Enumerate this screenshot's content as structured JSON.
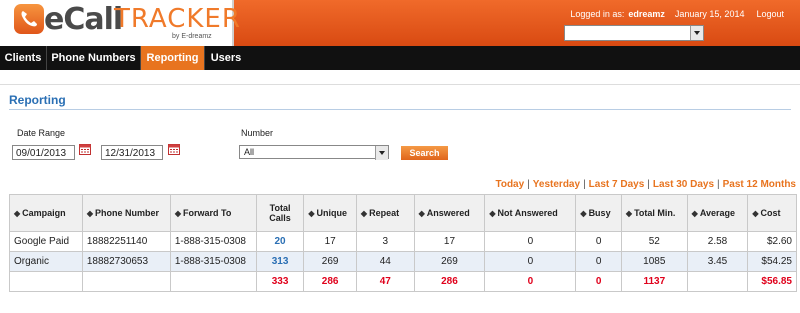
{
  "header": {
    "logo": {
      "brand_e": "eCall",
      "brand_tracker": "TRACKER",
      "byline": "by E-dreamz"
    },
    "logged_in_label": "Logged in as:",
    "username": "edreamz",
    "date": "January 15, 2014",
    "logout_label": "Logout",
    "client_select_value": ""
  },
  "nav": {
    "tabs": [
      {
        "label": "Clients",
        "active": false
      },
      {
        "label": "Phone Numbers",
        "active": false
      },
      {
        "label": "Reporting",
        "active": true
      },
      {
        "label": "Users",
        "active": false
      }
    ]
  },
  "page": {
    "title": "Reporting"
  },
  "filters": {
    "date_range_label": "Date Range",
    "start_date": "09/01/2013",
    "end_date": "12/31/2013",
    "number_label": "Number",
    "number_value": "All",
    "search_label": "Search"
  },
  "quick_ranges": [
    "Today",
    "Yesterday",
    "Last 7 Days",
    "Last 30 Days",
    "Past 12 Months"
  ],
  "table": {
    "sort_glyph": "◆",
    "columns": [
      "Campaign",
      "Phone Number",
      "Forward To",
      "Total Calls",
      "Unique",
      "Repeat",
      "Answered",
      "Not Answered",
      "Busy",
      "Total Min.",
      "Average",
      "Cost"
    ],
    "rows": [
      {
        "campaign": "Google Paid",
        "phone": "18882251140",
        "forward": "1-888-315-0308",
        "total_calls": "20",
        "unique": "17",
        "repeat": "3",
        "answered": "17",
        "not_answered": "0",
        "busy": "0",
        "total_min": "52",
        "average": "2.58",
        "cost": "$2.60"
      },
      {
        "campaign": "Organic",
        "phone": "18882730653",
        "forward": "1-888-315-0308",
        "total_calls": "313",
        "unique": "269",
        "repeat": "44",
        "answered": "269",
        "not_answered": "0",
        "busy": "0",
        "total_min": "1085",
        "average": "3.45",
        "cost": "$54.25"
      }
    ],
    "totals": {
      "total_calls": "333",
      "unique": "286",
      "repeat": "47",
      "answered": "286",
      "not_answered": "0",
      "busy": "0",
      "total_min": "1137",
      "average": "",
      "cost": "$56.85"
    }
  },
  "colors": {
    "accent": "#e8741f",
    "nav_bg": "#111111",
    "title_blue": "#2a6fb4",
    "totals_red": "#e0001b",
    "alt_row": "#e9eff7"
  },
  "icons": {
    "calendar": "calendar-icon",
    "logo": "phone-logo-icon",
    "sort": "sort-icon",
    "dropdown": "chevron-down-icon"
  }
}
